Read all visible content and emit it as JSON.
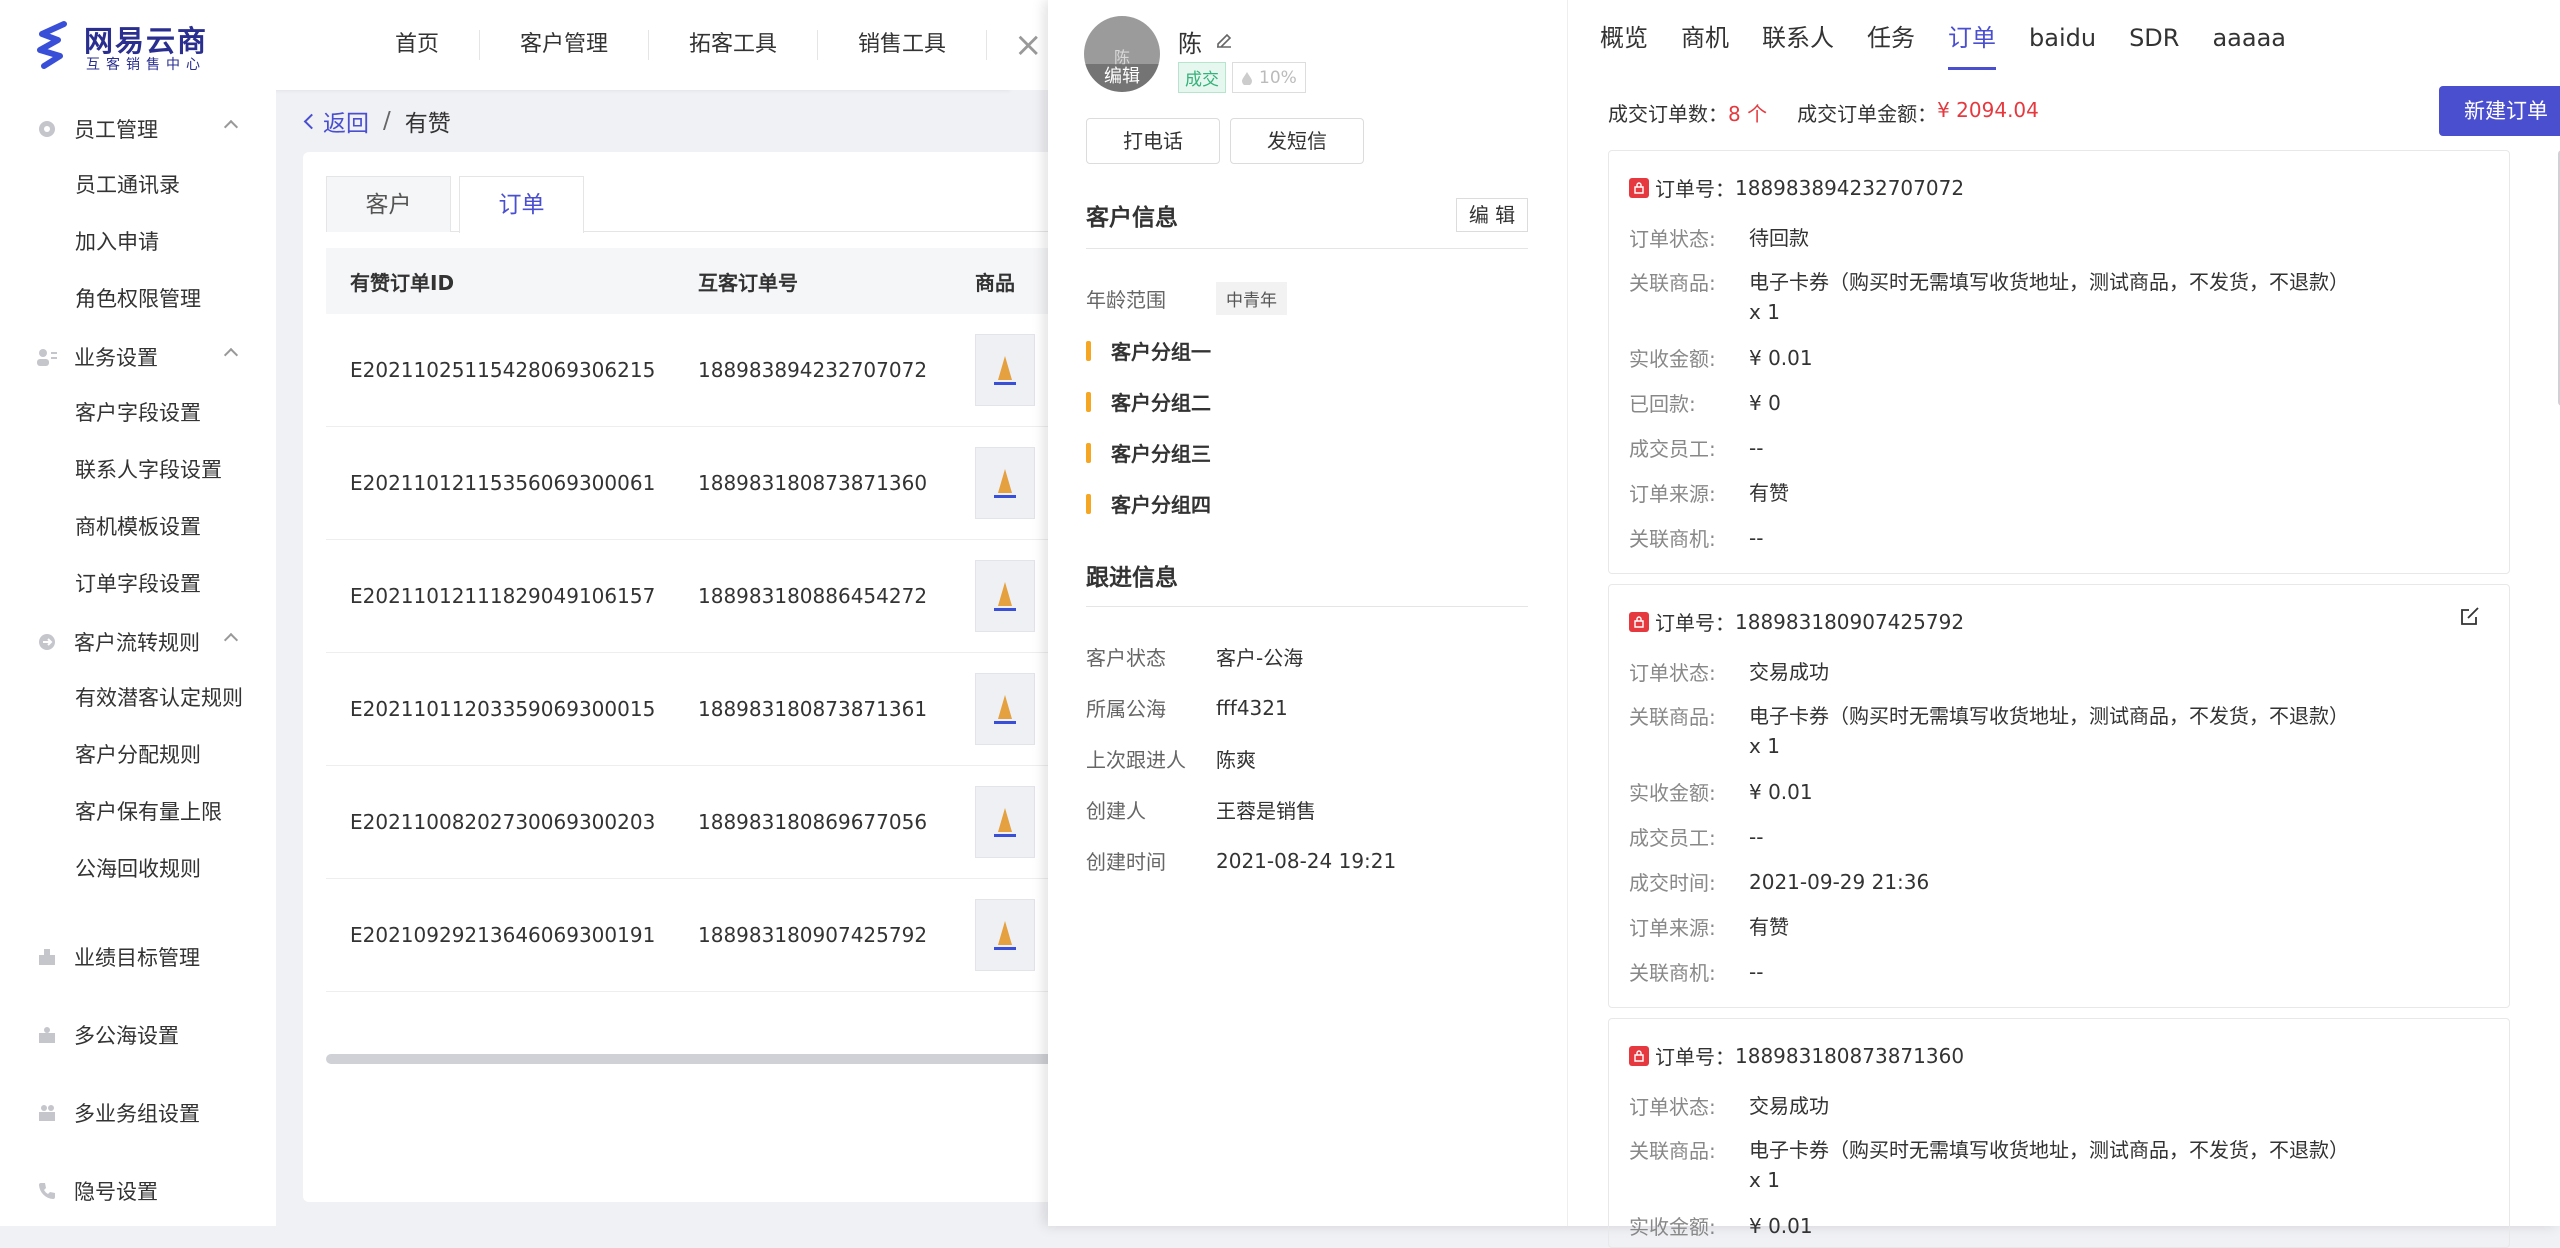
{
  "brand": {
    "title": "网易云商",
    "subtitle": "互客销售中心"
  },
  "topnav": [
    "首页",
    "客户管理",
    "拓客工具",
    "销售工具"
  ],
  "sidebar": {
    "groups": [
      {
        "label": "员工管理",
        "icon": "gear-icon",
        "items": [
          "员工通讯录",
          "加入申请",
          "角色权限管理"
        ]
      },
      {
        "label": "业务设置",
        "icon": "user-list-icon",
        "items": [
          "客户字段设置",
          "联系人字段设置",
          "商机模板设置",
          "订单字段设置"
        ]
      },
      {
        "label": "客户流转规则",
        "icon": "flow-icon",
        "items": [
          "有效潜客认定规则",
          "客户分配规则",
          "客户保有量上限",
          "公海回收规则"
        ]
      }
    ],
    "singles": [
      {
        "label": "业绩目标管理",
        "icon": "target-icon"
      },
      {
        "label": "多公海设置",
        "icon": "sea-icon"
      },
      {
        "label": "多业务组设置",
        "icon": "team-icon"
      },
      {
        "label": "隐号设置",
        "icon": "phone-icon"
      }
    ]
  },
  "breadcrumb": {
    "back": "返回",
    "current": "有赞"
  },
  "content_tabs": [
    "客户",
    "订单"
  ],
  "table": {
    "headers": [
      "有赞订单ID",
      "互客订单号",
      "商品"
    ],
    "rows": [
      [
        "E20211025115428069306215",
        "1889838942327070 72"
      ],
      [
        "E20211012115356069300061",
        "188983180873871360"
      ],
      [
        "E20211012111829049106157",
        "188983180886454272"
      ],
      [
        "E20211011203359069300015",
        "188983180873871361"
      ],
      [
        "E20211008202730069300203",
        "188983180869677056"
      ],
      [
        "E20210929213646069300191",
        "188983180907425792"
      ]
    ]
  },
  "customer": {
    "avatar_char": "陈",
    "avatar_edit": "编辑",
    "name": "陈",
    "deal_badge": "成交",
    "probability": "10%",
    "call_btn": "打电话",
    "sms_btn": "发短信",
    "info_title": "客户信息",
    "edit_btn": "编 辑",
    "age_label": "年龄范围",
    "age_value": "中青年",
    "groups": [
      "客户分组一",
      "客户分组二",
      "客户分组三",
      "客户分组四"
    ],
    "follow_title": "跟进信息",
    "follow": [
      {
        "k": "客户状态",
        "v": "客户-公海"
      },
      {
        "k": "所属公海",
        "v": "fff4321"
      },
      {
        "k": "上次跟进人",
        "v": "陈爽"
      },
      {
        "k": "创建人",
        "v": "王蓉是销售"
      },
      {
        "k": "创建时间",
        "v": "2021-08-24 19:21"
      }
    ]
  },
  "right_tabs": [
    "概览",
    "商机",
    "联系人",
    "任务",
    "订单",
    "baidu",
    "SDR",
    "aaaaa"
  ],
  "summary": {
    "count_label": "成交订单数：",
    "count": "8 个",
    "amount_label": "成交订单金额：",
    "amount": "¥ 2094.04"
  },
  "new_order_btn": "新建订单",
  "orders": [
    {
      "no_label": "订单号：",
      "no": "188983894232707072",
      "rows": [
        {
          "k": "订单状态:",
          "v": "待回款"
        },
        {
          "k": "关联商品:",
          "v": "电子卡券（购买时无需填写收货地址，测试商品，不发货，不退款） x 1"
        },
        {
          "k": "实收金额:",
          "v": "¥ 0.01"
        },
        {
          "k": "已回款:",
          "v": "¥ 0"
        },
        {
          "k": "成交员工:",
          "v": "--"
        },
        {
          "k": "订单来源:",
          "v": "有赞"
        },
        {
          "k": "关联商机:",
          "v": "--"
        }
      ]
    },
    {
      "no_label": "订单号：",
      "no": "188983180907425792",
      "rows": [
        {
          "k": "订单状态:",
          "v": "交易成功"
        },
        {
          "k": "关联商品:",
          "v": "电子卡券（购买时无需填写收货地址，测试商品，不发货，不退款） x 1"
        },
        {
          "k": "实收金额:",
          "v": "¥ 0.01"
        },
        {
          "k": "成交员工:",
          "v": "--"
        },
        {
          "k": "成交时间:",
          "v": "2021-09-29 21:36"
        },
        {
          "k": "订单来源:",
          "v": "有赞"
        },
        {
          "k": "关联商机:",
          "v": "--"
        }
      ]
    },
    {
      "no_label": "订单号：",
      "no": "188983180873871360",
      "rows": [
        {
          "k": "订单状态:",
          "v": "交易成功"
        },
        {
          "k": "关联商品:",
          "v": "电子卡券（购买时无需填写收货地址，测试商品，不发货，不退款） x 1"
        },
        {
          "k": "实收金额:",
          "v": "¥ 0.01"
        }
      ]
    }
  ],
  "colors": {
    "accent": "#4a4fd0",
    "red": "#e5393f",
    "tag_orange": "#f5a623",
    "deal_green": "#35b27a"
  }
}
